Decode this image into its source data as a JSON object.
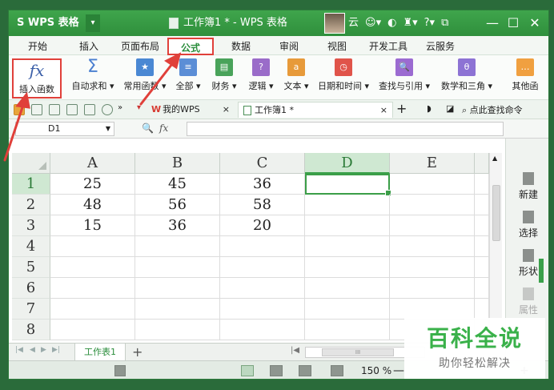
{
  "titlebar": {
    "app_name": "S WPS 表格",
    "app_menu_arrow": "▾",
    "doc_title": "工作簿1 * - WPS 表格",
    "cloud_label": "云",
    "icons": [
      "cloud-status-icon",
      "skin-icon",
      "shirt-icon",
      "help-icon",
      "restore-icon"
    ],
    "minimize": "—",
    "maximize": "☐",
    "close": "✕"
  },
  "menu": {
    "tabs": [
      "开始",
      "插入",
      "页面布局",
      "公式",
      "数据",
      "审阅",
      "视图",
      "开发工具",
      "云服务"
    ],
    "active_tab": "公式"
  },
  "ribbon": {
    "insert_function": "插入函数",
    "fx_symbol": "fx",
    "sigma_symbol": "Σ",
    "buttons": [
      "自动求和 ▾",
      "常用函数 ▾",
      "全部 ▾",
      "财务 ▾",
      "逻辑 ▾",
      "文本 ▾",
      "日期和时间 ▾",
      "查找与引用 ▾",
      "数学和三角 ▾",
      "其他函"
    ]
  },
  "quickbar": {
    "wps_tab": "我的WPS",
    "doc_tab": "工作簿1 *",
    "close_glyph": "×",
    "new_tab": "+",
    "search_label": "点此查找命令"
  },
  "formulabar": {
    "cell_ref": "D1",
    "zoom_glyph": "🔍",
    "fx_label": "fx",
    "value": ""
  },
  "grid": {
    "columns": [
      "A",
      "B",
      "C",
      "D",
      "E"
    ],
    "rows": [
      "1",
      "2",
      "3",
      "4",
      "5",
      "6",
      "7",
      "8"
    ],
    "data": [
      [
        "25",
        "45",
        "36",
        "",
        ""
      ],
      [
        "48",
        "56",
        "58",
        "",
        ""
      ],
      [
        "15",
        "36",
        "20",
        "",
        ""
      ],
      [
        "",
        "",
        "",
        "",
        ""
      ],
      [
        "",
        "",
        "",
        "",
        ""
      ],
      [
        "",
        "",
        "",
        "",
        ""
      ],
      [
        "",
        "",
        "",
        "",
        ""
      ],
      [
        "",
        "",
        "",
        "",
        ""
      ]
    ],
    "active_cell": "D1"
  },
  "rightpanel": {
    "items": [
      "新建",
      "选择",
      "形状",
      "属性"
    ]
  },
  "sheets": {
    "tabs": [
      "工作表1"
    ],
    "add": "+",
    "scroll_grip": "III"
  },
  "statusbar": {
    "zoom": "150 %",
    "zoom_minus": "—",
    "zoom_plus": "+"
  },
  "watermark": {
    "main": "百科全说",
    "sub": "助你轻松解决"
  },
  "colors": {
    "brand_green": "#2f8f3c",
    "highlight_red": "#e0403a",
    "selection_green": "#3b9e48"
  }
}
